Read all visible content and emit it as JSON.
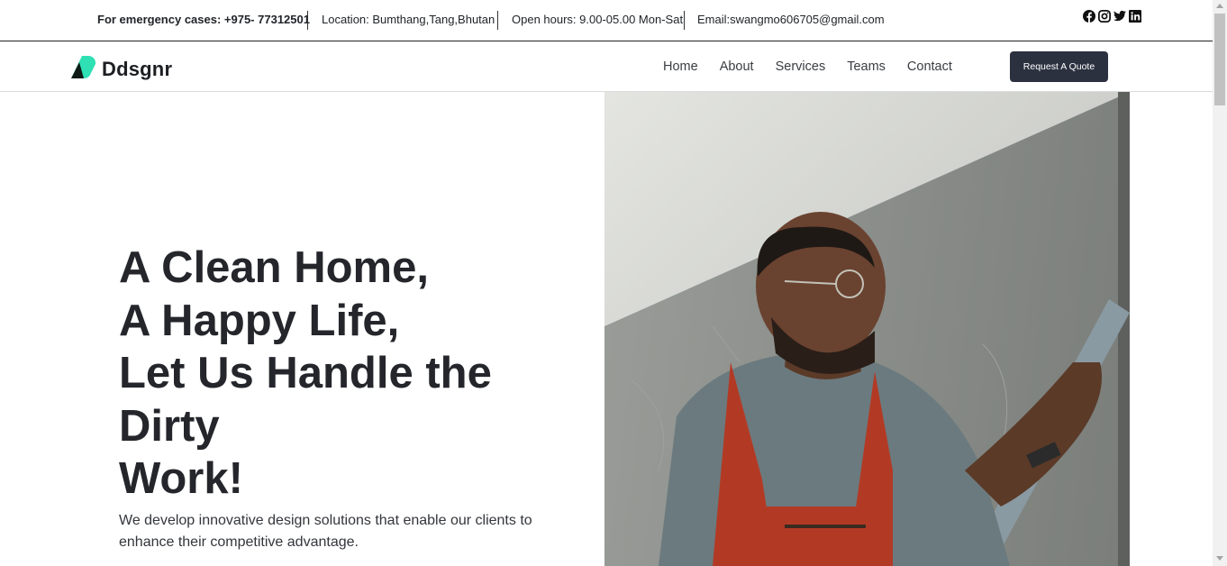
{
  "topbar": {
    "emergency": "For emergency cases: +975- 77312501",
    "location": "Location: Bumthang,Tang,Bhutan",
    "hours": "Open hours: 9.00-05.00 Mon-Sat",
    "email": "Email:swangmo606705@gmail.com",
    "socials": [
      "facebook-icon",
      "instagram-icon",
      "twitter-icon",
      "linkedin-icon"
    ]
  },
  "navbar": {
    "brand": "Ddsgnr",
    "links": [
      "Home",
      "About",
      "Services",
      "Teams",
      "Contact"
    ],
    "cta": "Request A Quote"
  },
  "hero": {
    "title_lines": [
      "A Clean Home,",
      "A Happy Life,",
      "Let Us Handle the",
      "Dirty",
      "Work!"
    ],
    "subtitle": "We develop innovative design solutions that enable our clients to enhance their competitive advantage."
  },
  "colors": {
    "brand_accent": "#2ee0b4",
    "button_bg": "#2c3140",
    "text_dark": "#24262b"
  }
}
